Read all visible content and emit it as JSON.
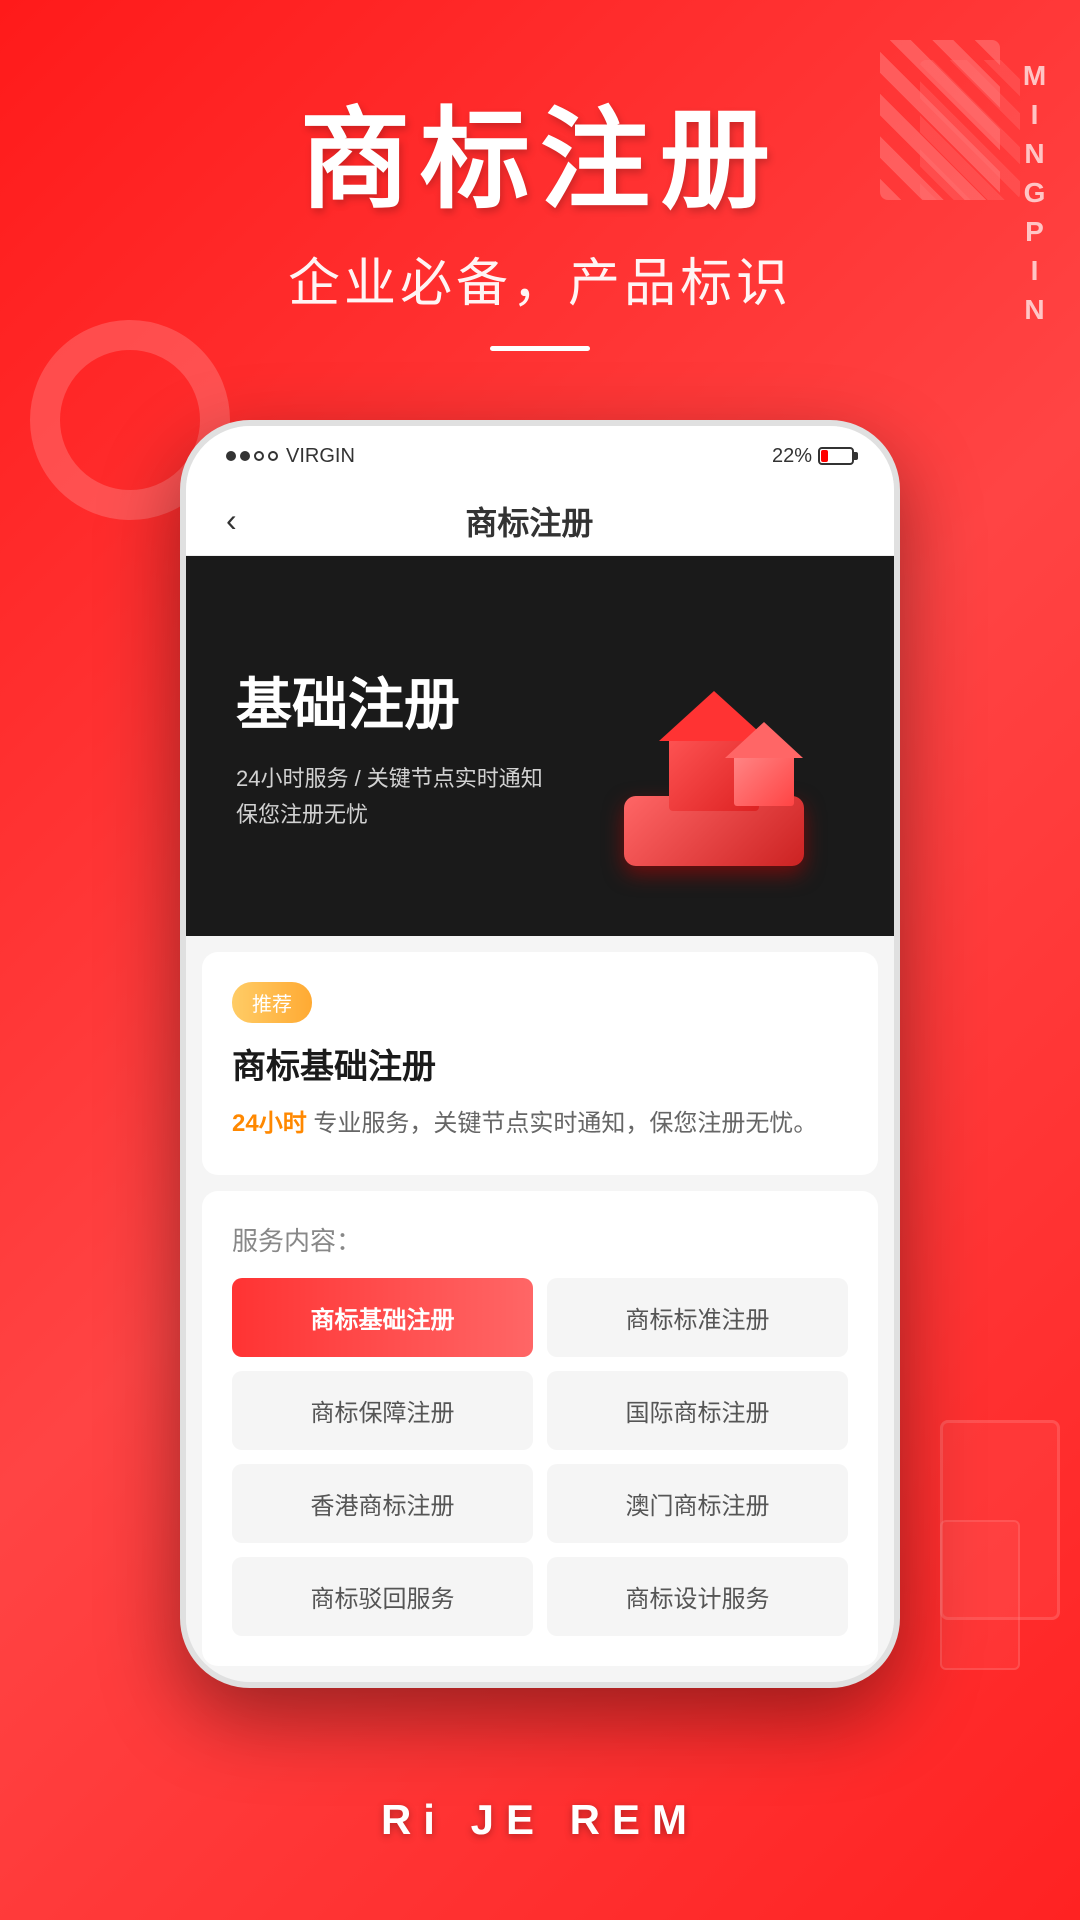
{
  "app": {
    "brand": "MINGPIN"
  },
  "header": {
    "title": "商标注册",
    "subtitle": "企业必备，产品标识",
    "divider": true
  },
  "phone": {
    "status_bar": {
      "signal": "●●○○",
      "carrier": "VIRGIN",
      "battery": "22%"
    },
    "nav": {
      "back_label": "‹",
      "title": "商标注册"
    },
    "banner": {
      "title": "基础注册",
      "desc_line1": "24小时服务 / 关键节点实时通知",
      "desc_line2": "保您注册无忧"
    },
    "info_card": {
      "tag": "推荐",
      "title": "商标基础注册",
      "desc_prefix": "",
      "highlight": "24小时",
      "desc_suffix": "专业服务，关键节点实时通知，保您注册无忧。"
    },
    "services": {
      "label": "服务内容：",
      "items": [
        {
          "label": "商标基础注册",
          "active": true
        },
        {
          "label": "商标标准注册",
          "active": false
        },
        {
          "label": "商标保障注册",
          "active": false
        },
        {
          "label": "国际商标注册",
          "active": false
        },
        {
          "label": "香港商标注册",
          "active": false
        },
        {
          "label": "澳门商标注册",
          "active": false
        },
        {
          "label": "商标驳回服务",
          "active": false
        },
        {
          "label": "商标设计服务",
          "active": false
        }
      ]
    }
  },
  "bottom": {
    "text": "Ri JE REM"
  },
  "colors": {
    "primary_red": "#ff2828",
    "accent_orange": "#ff8800",
    "banner_bg": "#1a1a1a",
    "active_btn_start": "#ff3333",
    "active_btn_end": "#ff6666"
  }
}
